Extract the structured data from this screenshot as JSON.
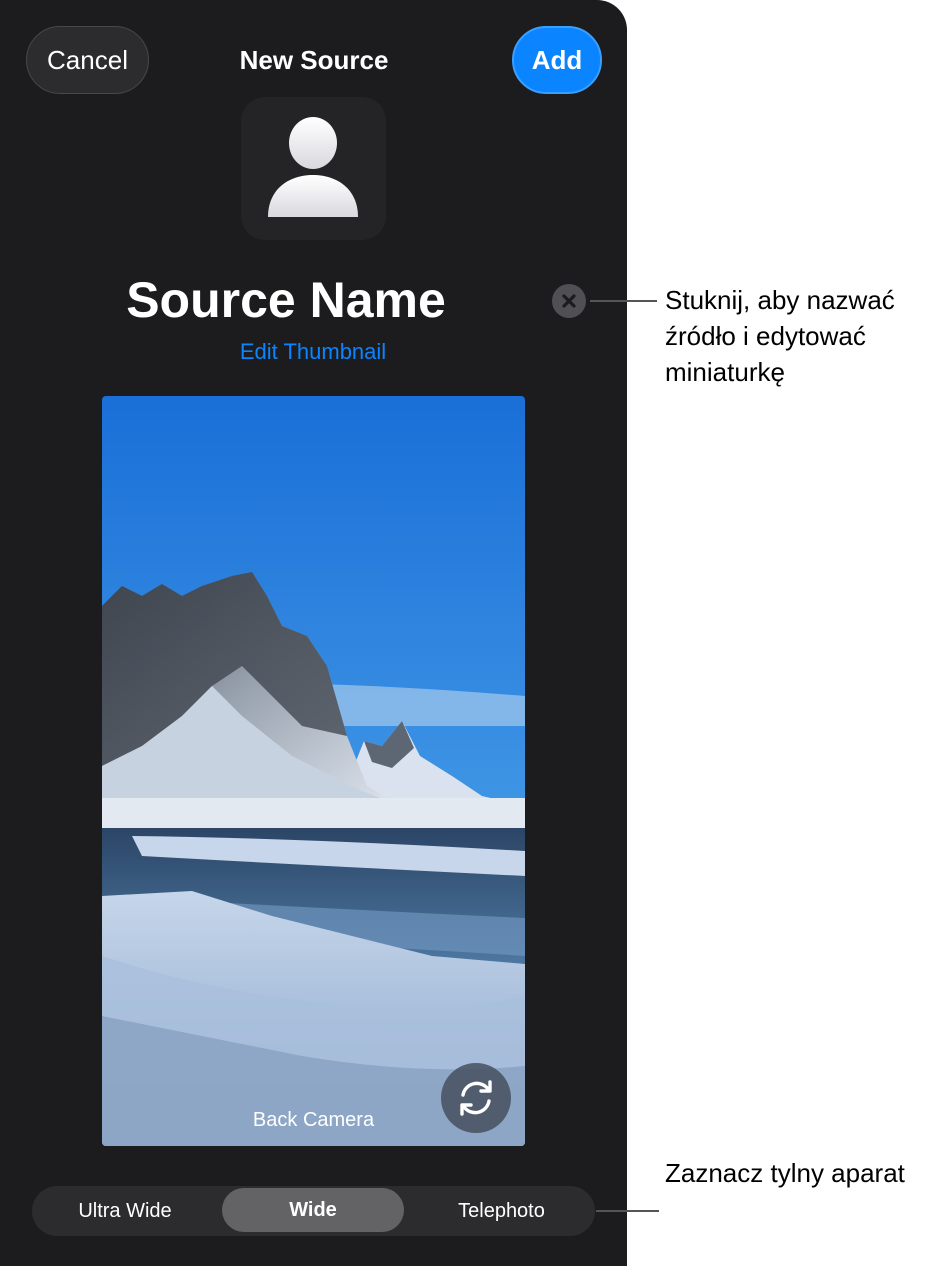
{
  "header": {
    "cancel_label": "Cancel",
    "title": "New Source",
    "add_label": "Add"
  },
  "source": {
    "name": "Source Name",
    "edit_thumbnail_label": "Edit Thumbnail"
  },
  "preview": {
    "camera_label": "Back Camera"
  },
  "lens_selector": {
    "options": [
      "Ultra Wide",
      "Wide",
      "Telephoto"
    ],
    "selected": "Wide"
  },
  "callouts": {
    "name_field": "Stuknij, aby nazwać źródło i edytować miniaturkę",
    "lens": "Zaznacz tylny aparat"
  },
  "icons": {
    "thumbnail": "person-icon",
    "clear": "clear-x-icon",
    "flip": "camera-flip-icon"
  },
  "colors": {
    "accent": "#0a84ff",
    "background": "#1c1c1e"
  }
}
